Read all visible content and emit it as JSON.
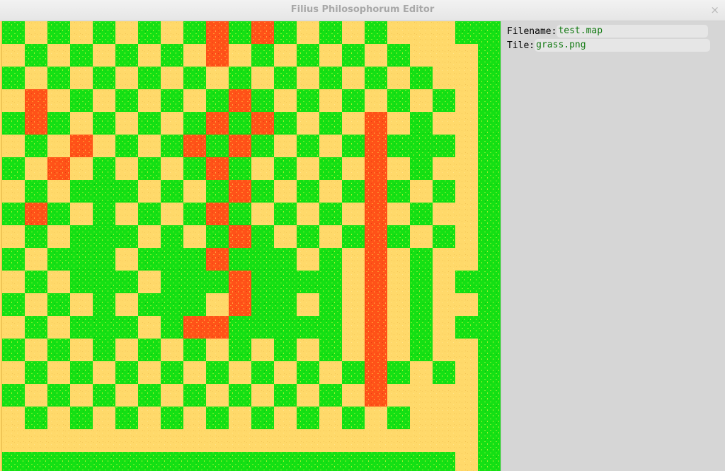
{
  "window": {
    "title": "Filius Philosophorum Editor",
    "close_glyph": "×"
  },
  "panel": {
    "filename": {
      "label": "Filename:",
      "value": "test.map"
    },
    "tile": {
      "label": "Tile:",
      "value": "grass.png"
    }
  },
  "colors": {
    "sand": "#ffd96a",
    "grass": "#10e010",
    "lava": "#ff5218",
    "panel": "#d6d6d6"
  },
  "map": {
    "legend": {
      "S": "sand",
      "G": "grass",
      "L": "lava"
    },
    "rows": [
      "GSGSGSGSGLGLGSGSGSSSGG",
      "SGSGSGSGSLSGSGSGSGSSSG",
      "GSGSGSGSGSGSGSGSGSGSSG",
      "SLSGSGSGSGLGSGSGSGSGSG",
      "GLGSGSGSGLGLGSGSLSGSSG",
      "SGSLSGSGLGLGSGSGLGGGSG",
      "GSLSGSGSGLGSGSGSLSGSSG",
      "SGSGGGSGSGLGSGSGLGSGSG",
      "GLGSGSGSGLGSGSGSLSGSSG",
      "SGSGGGSGSGLGSGSGLGSGSG",
      "GSGGGSGGGLGGGSGSLSGSSG",
      "SGSGGGSGGGLGGGGSLSGSGG",
      "GSGSGSGGGSLGGSGSLSGSSG",
      "SGSGGGSGLLGGGGGSLSGSGG",
      "GSGSGSGSGSGSGSGSLSGSSG",
      "SGSGSGSGSGSGSGSGLGSGSG",
      "GSGSGSGSGSGSGSGSLSSSSG",
      "SGSGSGSGSGSGSGSGSGSSSG",
      "SSSSSSSSSSSSSSSSSSSSSG",
      "GGGGGGGGGGGGGGGGGGGGSG"
    ]
  }
}
